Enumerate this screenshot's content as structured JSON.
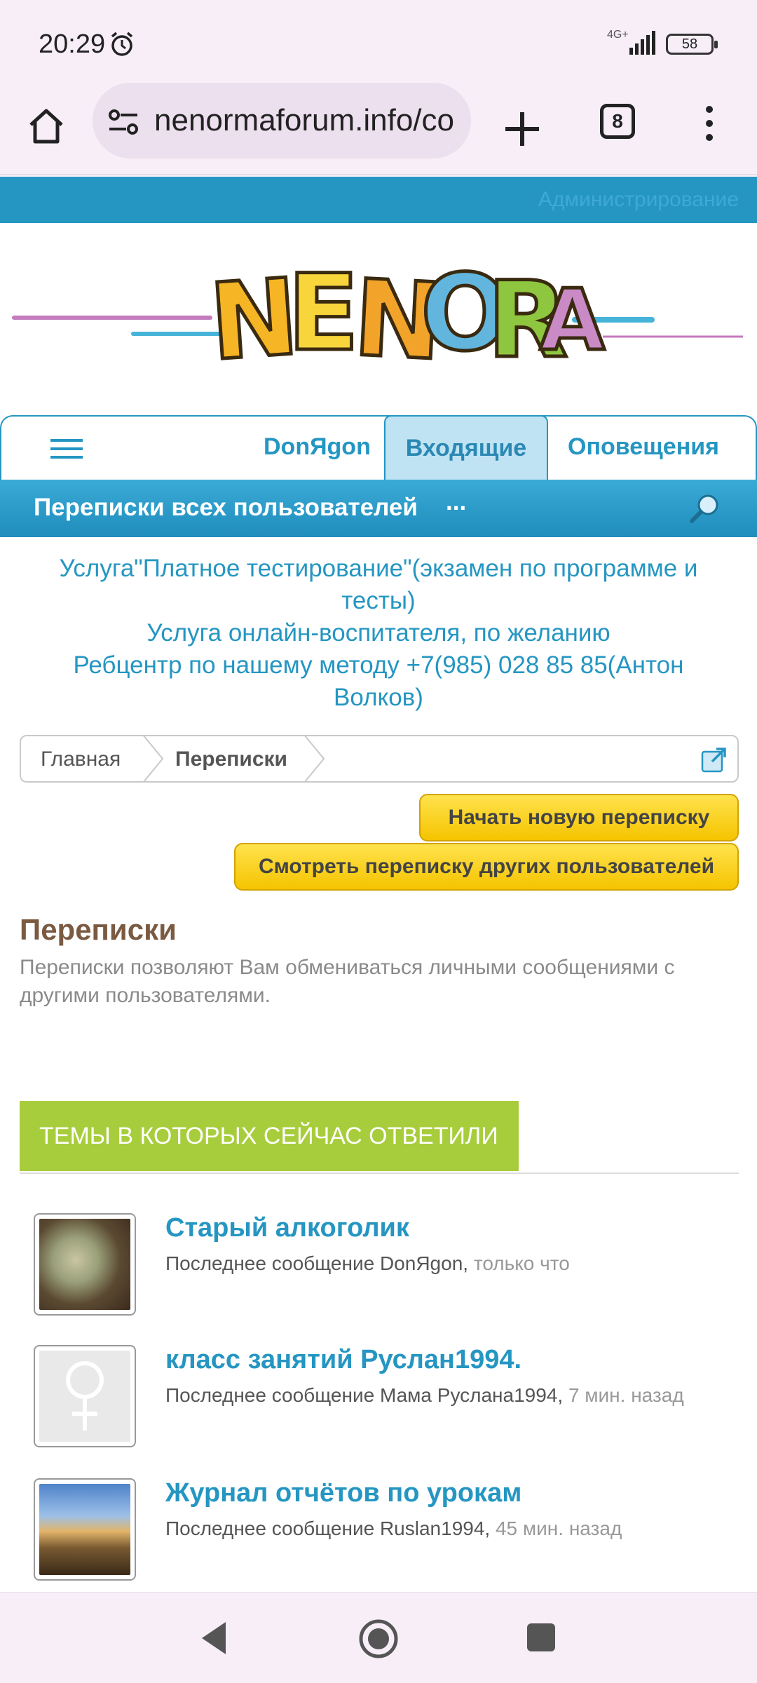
{
  "status_bar": {
    "time": "20:29",
    "network": "4G+",
    "battery": "58"
  },
  "browser": {
    "url": "nenormaforum.info/co",
    "tab_count": "8"
  },
  "admin_bar": {
    "link": "Администрирование"
  },
  "logo": {
    "text": "NENORMA"
  },
  "nav": {
    "user": "DonЯgon",
    "inbox": "Входящие",
    "alerts": "Оповещения"
  },
  "subbar": {
    "title": "Переписки всех пользователей",
    "more": "..."
  },
  "notice": {
    "line1": "Услуга\"Платное тестирование\"(экзамен по программе и тесты)",
    "line2": "Услуга онлайн-воспитателя, по желанию",
    "line3": "Ребцентр по нашему методу +7(985) 028 85 85(Антон Волков)"
  },
  "breadcrumb": {
    "home": "Главная",
    "current": "Переписки"
  },
  "buttons": {
    "new_conversation": "Начать новую переписку",
    "view_others": "Смотреть переписку других пользователей"
  },
  "section": {
    "title": "Переписки",
    "description": "Переписки позволяют Вам обмениваться личными сообщениями с другими пользователями."
  },
  "recent": {
    "header": "ТЕМЫ В КОТОРЫХ СЕЙЧАС ОТВЕТИЛИ",
    "threads": [
      {
        "title": "Старый алкоголик",
        "meta_prefix": "Последнее сообщение DonЯgon,",
        "time": "только что"
      },
      {
        "title": "класс занятий Руслан1994.",
        "meta_prefix": "Последнее сообщение Мама Руслана1994,",
        "time": "7 мин. назад"
      },
      {
        "title": "Журнал отчётов по урокам",
        "meta_prefix": "Последнее сообщение Ruslan1994,",
        "time": "45 мин. назад"
      }
    ]
  },
  "colors": {
    "accent": "#2596c2",
    "green_header": "#a8cd3c",
    "button_yellow": "#f5c400",
    "section_title": "#7b5a42"
  }
}
